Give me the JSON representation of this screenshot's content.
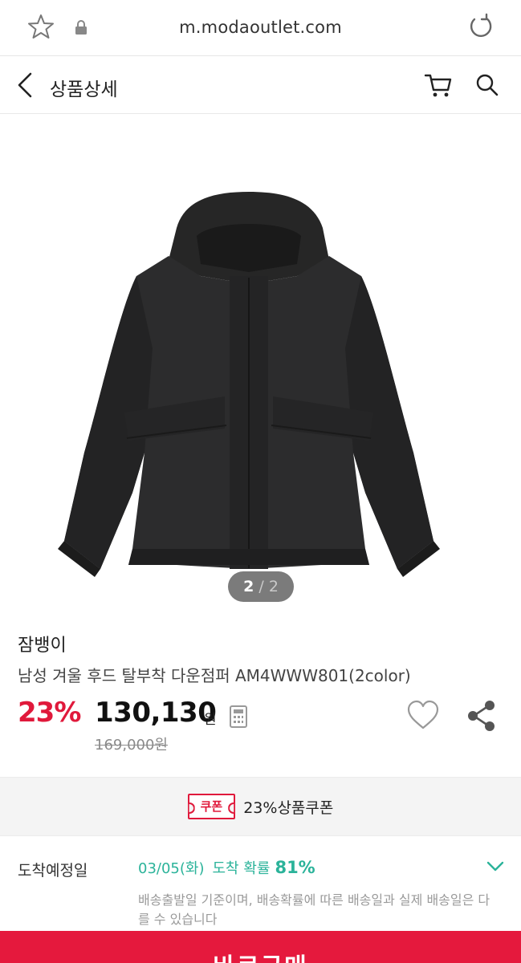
{
  "browser": {
    "url": "m.modaoutlet.com",
    "icons": [
      "star-icon",
      "lock-icon",
      "reload-icon"
    ]
  },
  "header": {
    "title": "상품상세",
    "icons": [
      "back-arrow-icon",
      "cart-icon",
      "search-icon"
    ]
  },
  "gallery": {
    "current": "2",
    "separator": "/",
    "total": "2"
  },
  "product": {
    "brand": "잠뱅이",
    "name": "남성 겨울 후드 탈부착 다운점퍼 AM4WWW801(2color)",
    "discount": "23%",
    "price": "130,130",
    "currency": "원",
    "original_price": "169,000원"
  },
  "coupon": {
    "tag": "쿠폰",
    "text": "23%상품쿠폰"
  },
  "delivery": {
    "label": "도착예정일",
    "date": "03/05(화)",
    "probability_label": "도착 확률",
    "probability": "81%",
    "note": "배송출발일 기준이며, 배송확률에 따른 배송일과 실제 배송일은 다를 수 있습니다"
  },
  "buy": {
    "label": "바로구매"
  },
  "colors": {
    "accent": "#e0193b",
    "delivery": "#2bb39a",
    "buy_bar": "#e5193d"
  }
}
